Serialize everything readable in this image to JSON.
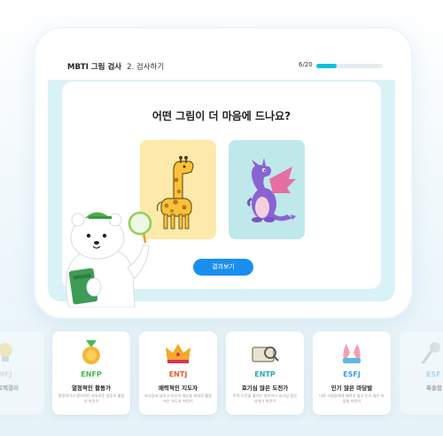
{
  "header": {
    "title": "MBTI 그림 검사",
    "step": "2. 검사하기",
    "progress_text": "6/20",
    "progress_fraction": 0.3
  },
  "question": {
    "text": "어떤 그림이 더 마음에 드나요?",
    "choices": [
      {
        "icon": "giraffe-icon",
        "bg": "#fde9a9"
      },
      {
        "icon": "dragon-icon",
        "bg": "#bfe8ea"
      }
    ],
    "result_button": "결과보기"
  },
  "colors": {
    "accent": "#11bfe0",
    "button": "#1a8ff0"
  },
  "types": [
    {
      "code": "NFJ",
      "nick": "프로젝결리",
      "desc": "",
      "color": "#d9a0c0",
      "icon": "bulb-icon"
    },
    {
      "code": "ENFP",
      "nick": "열정적인 활동가",
      "desc": "열정적이고 창의적인 자유로운 영혼의 활동가 머린이",
      "color": "#49b84c",
      "icon": "medal-icon"
    },
    {
      "code": "ENTJ",
      "nick": "매력적인 지도자",
      "desc": "자신감과 넘치고 자신의 재능을 최대로 활용하는 지도자 머린이",
      "color": "#e85b2a",
      "icon": "crown-icon"
    },
    {
      "code": "ENTP",
      "nick": "호기심 많은 도전가",
      "desc": "지적 도전을 즐기는 영리하고 호기심 많은 사색가 머린이",
      "color": "#2fa7b5",
      "icon": "book-icon"
    },
    {
      "code": "ESFJ",
      "nick": "인기 많은 마당발",
      "desc": "다른 사람들에게 배려가 많고 인기 많은 마당발 머린이",
      "color": "#3a9ee0",
      "icon": "hands-icon"
    },
    {
      "code": "ESF",
      "nick": "특출함",
      "desc": "",
      "color": "#3a9ee0",
      "icon": "mic-icon"
    }
  ]
}
